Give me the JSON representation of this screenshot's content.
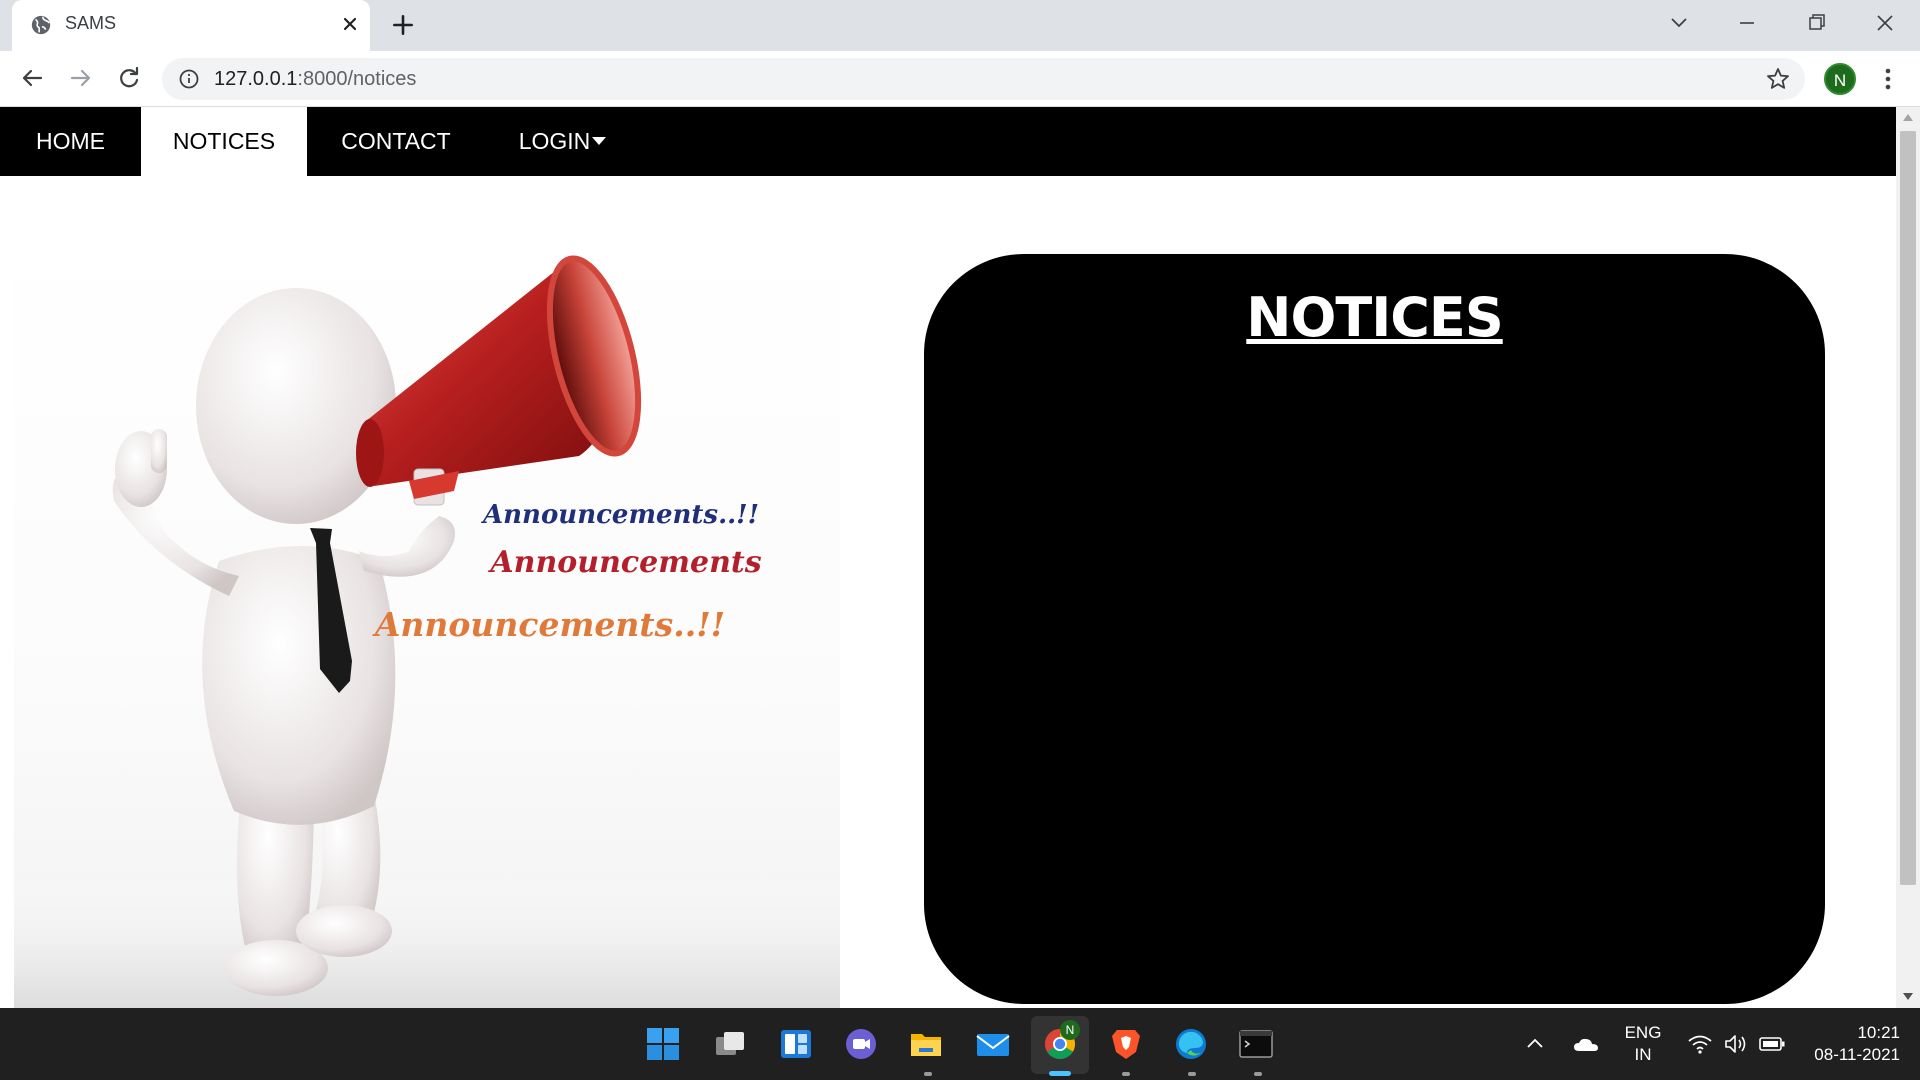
{
  "browser": {
    "tab_title": "SAMS",
    "url_host": "127.0.0.1",
    "url_rest": ":8000/notices",
    "profile_initial": "N",
    "icons": [
      "globe-icon",
      "close-icon",
      "plus-icon",
      "chevron-down-icon",
      "minimize-icon",
      "restore-icon",
      "back-icon",
      "forward-icon",
      "reload-icon",
      "info-icon",
      "star-icon",
      "more-vert-icon"
    ]
  },
  "site": {
    "nav": {
      "home": "HOME",
      "notices": "NOTICES",
      "contact": "CONTACT",
      "login": "LOGIN"
    },
    "hero": {
      "announcement_1": "Announcements..!!",
      "announcement_2": "Announcements",
      "announcement_3": "Announcements..!!",
      "colors": {
        "line1": "#1f2f7a",
        "line2": "#b3202b",
        "line3": "#e07a3a",
        "megaphone": "#c62828"
      }
    },
    "notices": {
      "heading": "NOTICES"
    }
  },
  "taskbar": {
    "apps": [
      "windows-start-icon",
      "task-view-icon",
      "widgets-icon",
      "teams-chat-icon",
      "file-explorer-icon",
      "mail-icon",
      "chrome-icon",
      "brave-icon",
      "edge-icon",
      "terminal-icon"
    ],
    "chrome_badge": "N",
    "language_line1": "ENG",
    "language_line2": "IN",
    "time": "10:21",
    "date": "08-11-2021"
  }
}
